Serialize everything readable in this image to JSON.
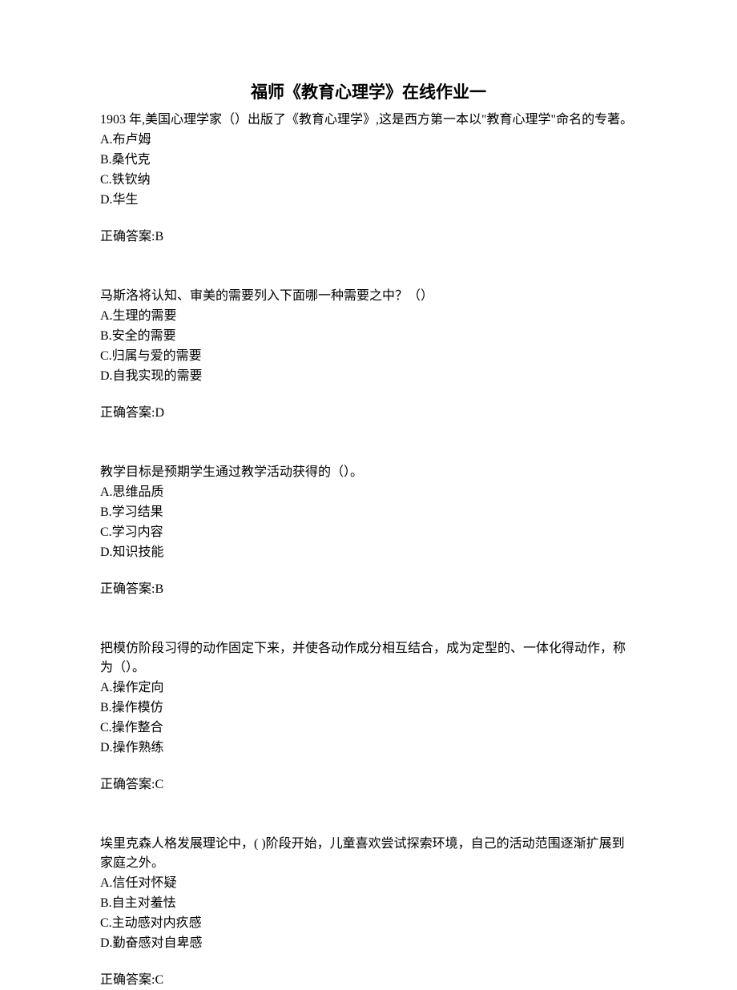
{
  "title": "福师《教育心理学》在线作业一",
  "questions": [
    {
      "text": "1903 年,美国心理学家（）出版了《教育心理学》,这是西方第一本以\"教育心理学\"命名的专著。",
      "options": [
        "A.布卢姆",
        "B.桑代克",
        "C.铁钦纳",
        "D.华生"
      ],
      "answer": "正确答案:B"
    },
    {
      "text": "马斯洛将认知、审美的需要列入下面哪一种需要之中？（）",
      "options": [
        "A.生理的需要",
        "B.安全的需要",
        "C.归属与爱的需要",
        "D.自我实现的需要"
      ],
      "answer": "正确答案:D"
    },
    {
      "text": "教学目标是预期学生通过教学活动获得的（）。",
      "options": [
        "A.思维品质",
        "B.学习结果",
        "C.学习内容",
        "D.知识技能"
      ],
      "answer": "正确答案:B"
    },
    {
      "text": "把模仿阶段习得的动作固定下来，并使各动作成分相互结合，成为定型的、一体化得动作，称为（）。",
      "options": [
        "A.操作定向",
        "B.操作模仿",
        "C.操作整合",
        "D.操作熟练"
      ],
      "answer": "正确答案:C"
    },
    {
      "text": "埃里克森人格发展理论中，( )阶段开始，儿童喜欢尝试探索环境，自己的活动范围逐渐扩展到家庭之外。",
      "options": [
        "A.信任对怀疑",
        "B.自主对羞怯",
        "C.主动感对内疚感",
        "D.勤奋感对自卑感"
      ],
      "answer": "正确答案:C"
    }
  ]
}
